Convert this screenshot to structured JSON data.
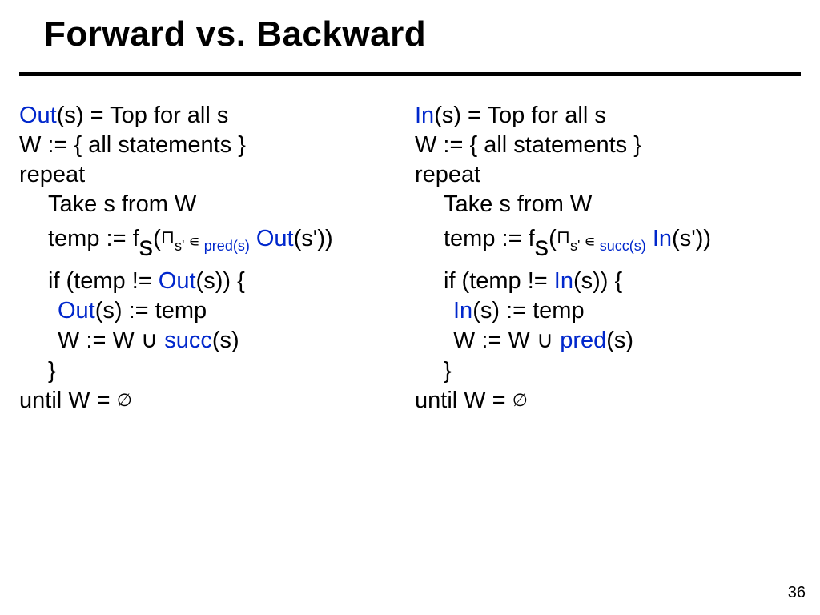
{
  "title": "Forward vs. Backward",
  "page": "36",
  "sym": {
    "meet": "⊓",
    "in": "∊",
    "union": "∪",
    "empty": "∅",
    "prime": "ʹ"
  },
  "left": {
    "l1a": "Out",
    "l1b": "(s) = Top  for all s",
    "l2": "W := { all statements }",
    "l3": "repeat",
    "l4": "Take s from W",
    "l5a": "temp := f",
    "l5sub_s": "s",
    "l5open": "(",
    "l5subprime": "sʹ ",
    "l5rel": "pred(s)",
    "l5sp": " ",
    "l5out": "Out",
    "l5close": "(sʹ))",
    "l6a": "if (temp != ",
    "l6out": "Out",
    "l6b": "(s)) {",
    "l7out": "Out",
    "l7b": "(s) := temp",
    "l8a": "W := W ",
    "l8b": " ",
    "l8succ": "succ",
    "l8c": "(s)",
    "l9": "}",
    "l10a": "until W = "
  },
  "right": {
    "l1a": "In",
    "l1b": "(s) = Top  for all s",
    "l2": "W := { all statements }",
    "l3": "repeat",
    "l4": "Take s from W",
    "l5a": "temp := f",
    "l5sub_s": "s",
    "l5open": "(",
    "l5subprime": "sʹ ",
    "l5rel": "succ(s)",
    "l5sp": " ",
    "l5in": "In",
    "l5close": "(sʹ))",
    "l6a": "if (temp != ",
    "l6in": "In",
    "l6b": "(s)) {",
    "l7in": "In",
    "l7b": "(s) := temp",
    "l8a": "W := W ",
    "l8b": " ",
    "l8pred": "pred",
    "l8c": "(s)",
    "l9": "}",
    "l10a": "until W = "
  }
}
